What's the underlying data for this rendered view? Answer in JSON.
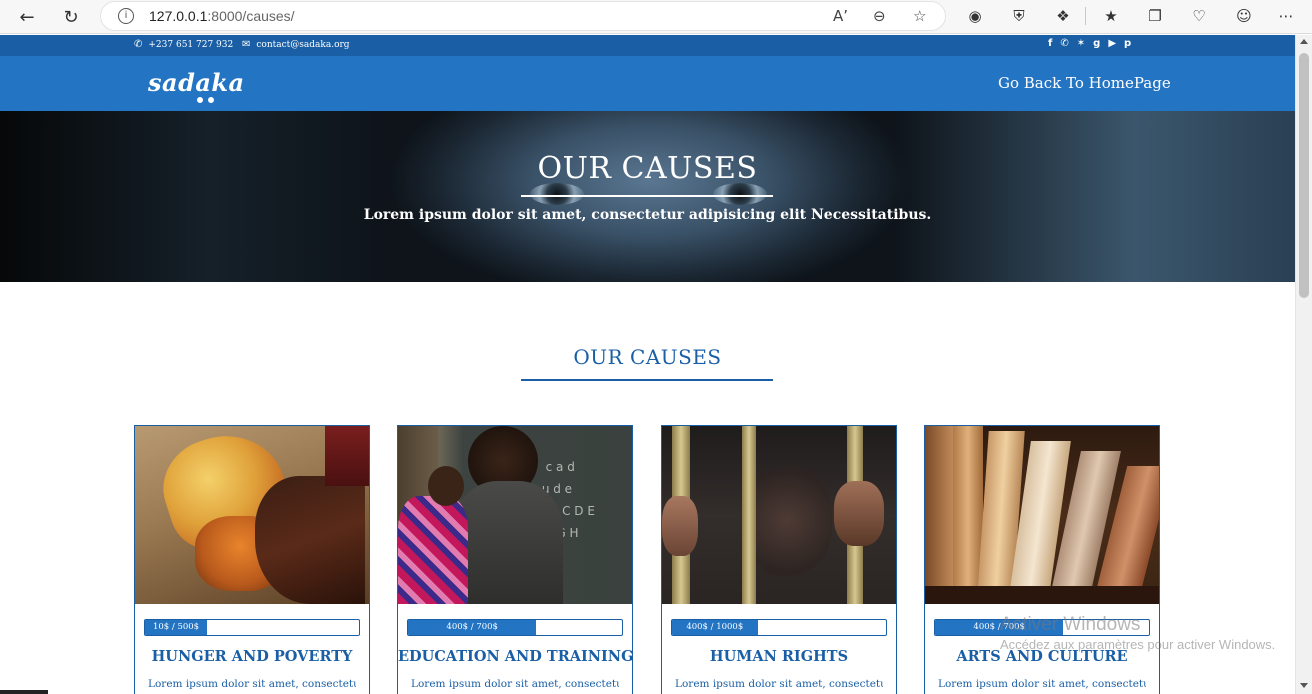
{
  "browser": {
    "url_host": "127.0.0.1",
    "url_rest": ":8000/causes/",
    "reader_label": "Aʼ"
  },
  "topbar": {
    "phone": "+237 651 727 932",
    "email": "contact@sadaka.org",
    "socials": [
      "f",
      "✆",
      "✶",
      "g",
      "▶",
      "p"
    ]
  },
  "header": {
    "logo": "sadaka",
    "home_link": "Go Back To HomePage"
  },
  "hero": {
    "title": "OUR CAUSES",
    "subtitle": "Lorem ipsum dolor sit amet, consectetur adipisicing elit Necessitatibus."
  },
  "section": {
    "title": "OUR CAUSES"
  },
  "causes": [
    {
      "title": "HUNGER AND POVERTY",
      "raised_label": "10$ / 500$",
      "progress": 0.29,
      "desc": "Lorem ipsum dolor sit amet, consectetur",
      "image": "hunger-image"
    },
    {
      "title": "EDUCATION AND TRAINING",
      "raised_label": "400$ / 700$",
      "progress": 0.6,
      "desc": "Lorem ipsum dolor sit amet, consectetur",
      "image": "education-image"
    },
    {
      "title": "HUMAN RIGHTS",
      "raised_label": "400$ / 1000$",
      "progress": 0.4,
      "desc": "Lorem ipsum dolor sit amet, consectetur",
      "image": "human-rights-image"
    },
    {
      "title": "ARTS AND CULTURE",
      "raised_label": "400$ / 700$",
      "progress": 0.6,
      "desc": "Lorem ipsum dolor sit amet, consectetur",
      "image": "arts-image"
    }
  ],
  "watermark": {
    "line1": "Activer Windows",
    "line2": "Accédez aux paramètres pour activer Windows."
  },
  "colors": {
    "primary": "#2474c4",
    "primary_dark": "#1a5fa6"
  }
}
